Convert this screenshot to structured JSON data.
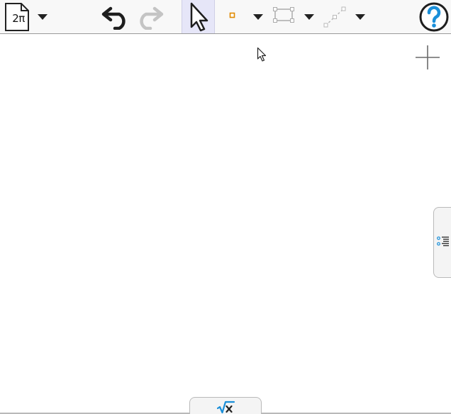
{
  "toolbar": {
    "document_menu": {
      "label": "2π",
      "icon": "document-icon"
    },
    "tools": [
      {
        "name": "undo",
        "icon": "undo-arrow-icon",
        "enabled": true
      },
      {
        "name": "redo",
        "icon": "redo-arrow-icon",
        "enabled": false
      },
      {
        "name": "move",
        "icon": "arrow-pointer-icon",
        "selected": true
      },
      {
        "name": "point",
        "icon": "point-icon"
      },
      {
        "name": "segment",
        "icon": "segment-icon"
      },
      {
        "name": "line",
        "icon": "line-icon"
      }
    ],
    "help_icon": "question-mark-icon"
  },
  "canvas": {
    "zoom_control_icon": "plus-icon",
    "cursor_icon": "mouse-pointer-icon"
  },
  "side_panel_toggle": {
    "icon": "algebra-list-icon"
  },
  "bottom_keyboard_toggle": {
    "icon": "square-root-x-icon",
    "label": "√x"
  },
  "colors": {
    "toolbar_bg": "#f8f8f8",
    "selected_tool_bg": "#e6e6f8",
    "accent_blue": "#1a8fd9",
    "point_orange": "#e08a00",
    "disabled_gray": "#b9b9b9",
    "border_gray": "#9a9a9a"
  }
}
